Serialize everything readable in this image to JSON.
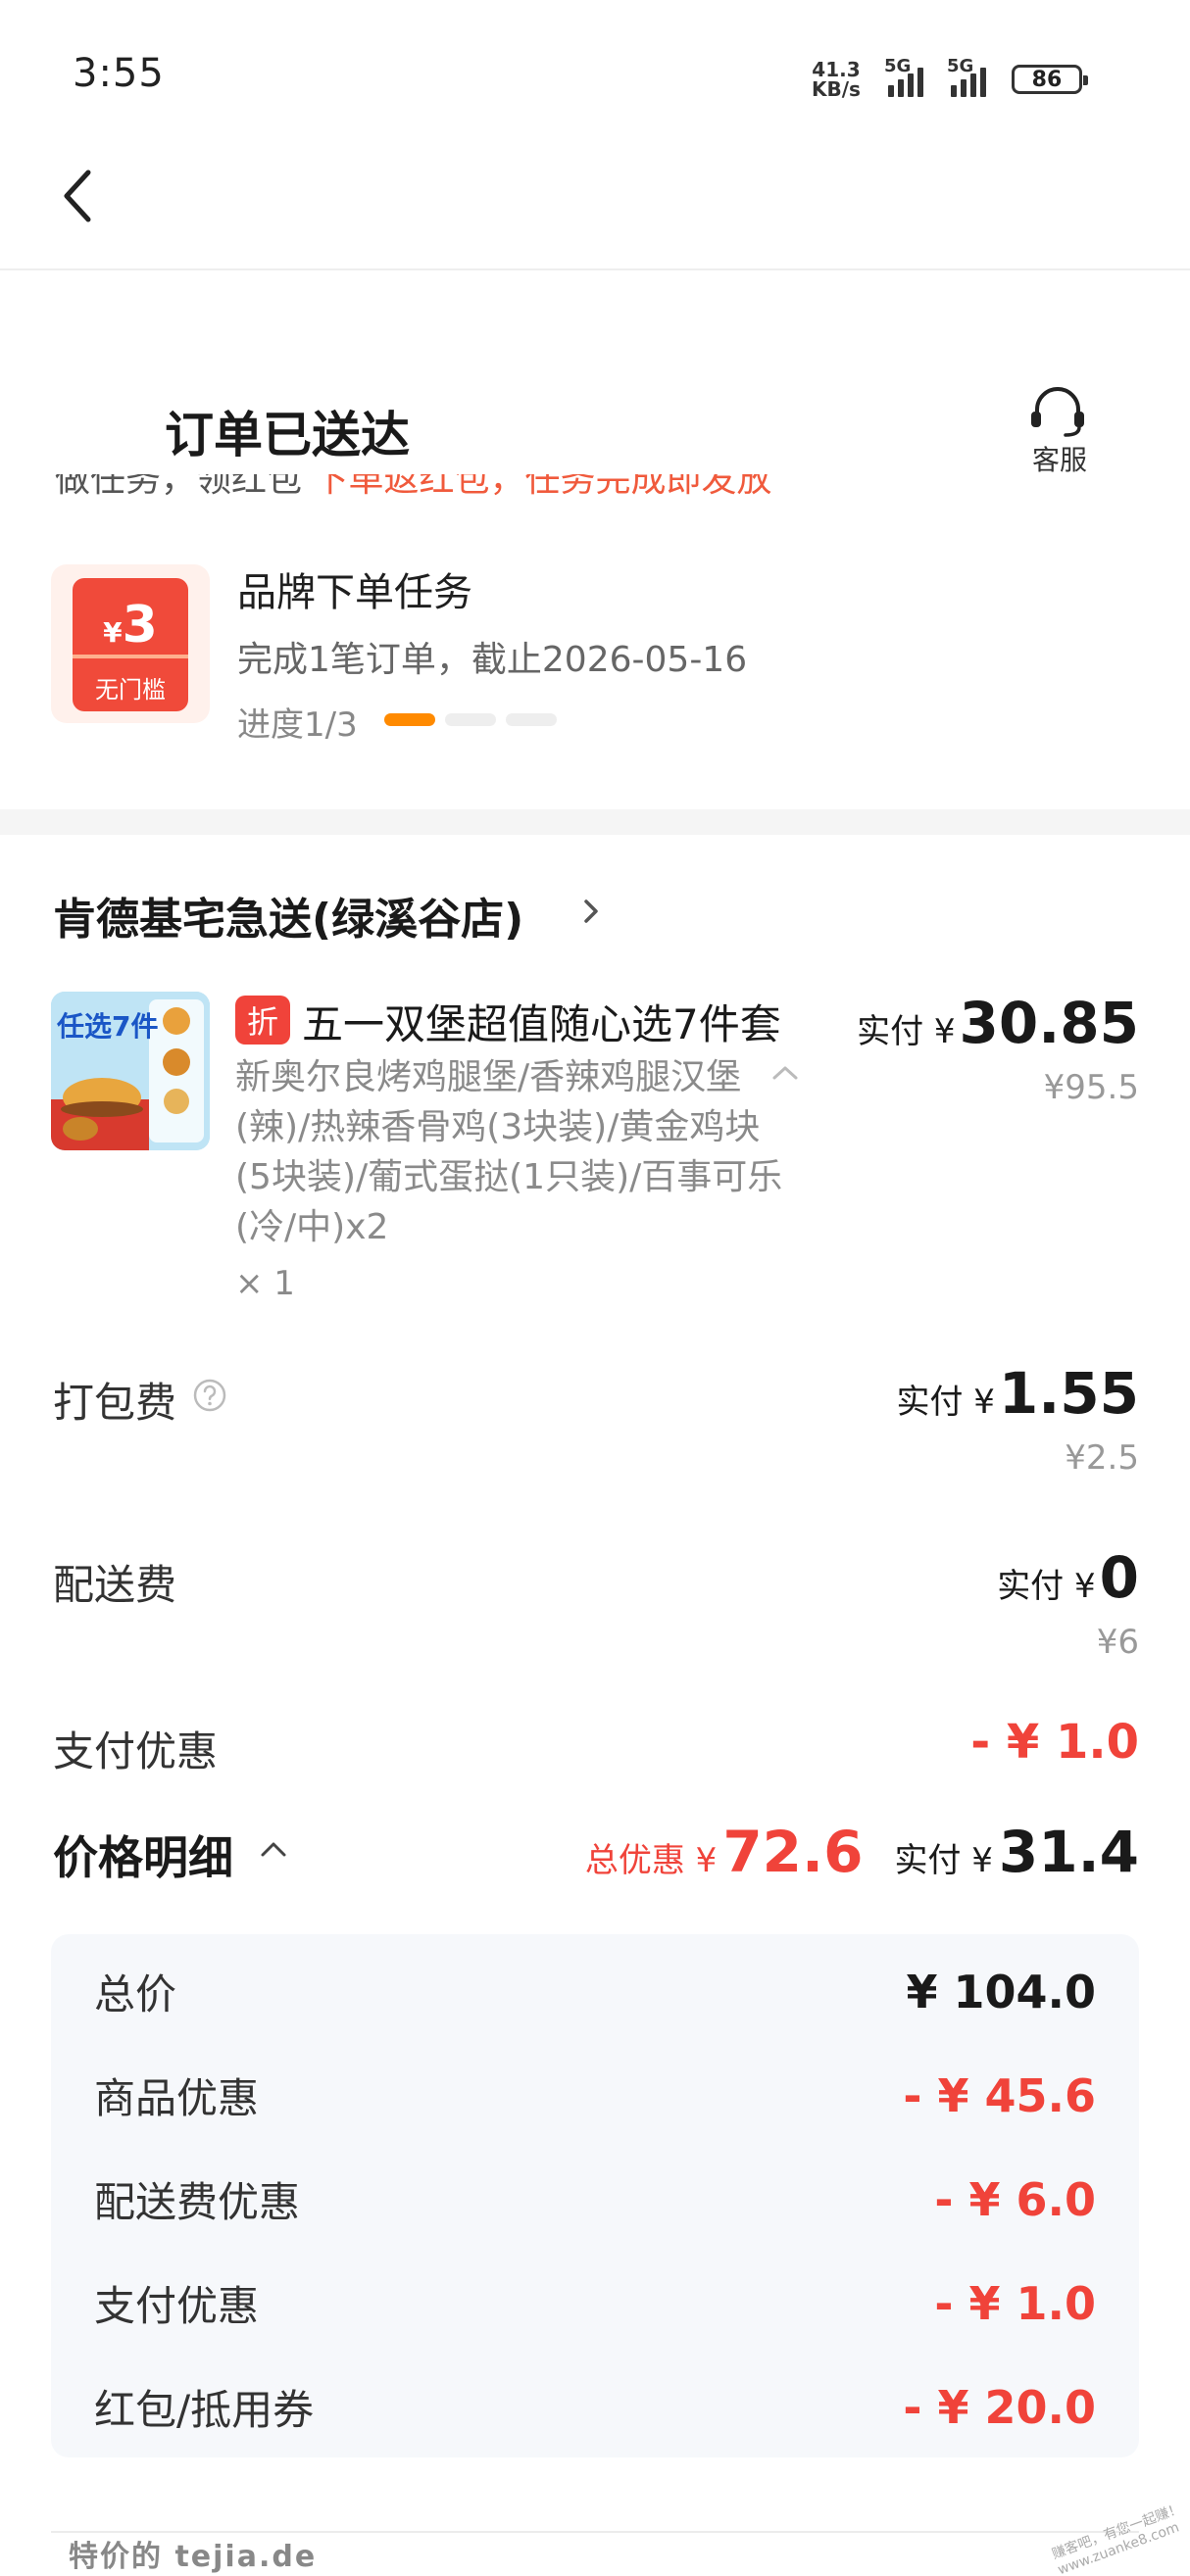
{
  "status_bar": {
    "time": "3:55",
    "net_speed_value": "41.3",
    "net_speed_unit": "KB/s",
    "sim1": "5G",
    "sim2": "5G",
    "battery": "86"
  },
  "header": {
    "title": "订单已送达",
    "service_label": "客服"
  },
  "task": {
    "partial_text_dark": "做任务，领红包",
    "partial_text_red": "下单返红包，任务完成即发放",
    "coupon_symbol": "¥",
    "coupon_amount": "3",
    "coupon_label": "无门槛",
    "name": "品牌下单任务",
    "desc": "完成1笔订单，截止2026-05-16",
    "progress_label": "进度1/3",
    "progress_done": 1,
    "progress_total": 3
  },
  "store": {
    "name": "肯德基宅急送(绿溪谷店)"
  },
  "product": {
    "badge": "折",
    "name": "五一双堡超值随心选7件套",
    "desc": "新奥尔良烤鸡腿堡/香辣鸡腿汉堡(辣)/热辣香骨鸡(3块装)/黄金鸡块(5块装)/葡式蛋挞(1只装)/百事可乐(冷/中)x2",
    "qty": "× 1",
    "pay_label": "实付 ¥",
    "pay_amount": "30.85",
    "original": "¥95.5",
    "image_text": "任选7件"
  },
  "fees": {
    "packing": {
      "label": "打包费",
      "pay_label": "实付 ¥",
      "amount": "1.55",
      "original": "¥2.5"
    },
    "delivery": {
      "label": "配送费",
      "pay_label": "实付 ¥",
      "amount": "0",
      "original": "¥6"
    },
    "pay_discount": {
      "label": "支付优惠",
      "amount": "- ¥ 1.0"
    }
  },
  "price_detail": {
    "title": "价格明细",
    "total_off_label": "总优惠 ¥",
    "total_off_amount": "72.6",
    "pay_label": "实付 ¥",
    "pay_amount": "31.4",
    "rows": [
      {
        "label": "总价",
        "value": "¥ 104.0"
      },
      {
        "label": "商品优惠",
        "value": "- ¥ 45.6"
      },
      {
        "label": "配送费优惠",
        "value": "- ¥ 6.0"
      },
      {
        "label": "支付优惠",
        "value": "- ¥ 1.0"
      },
      {
        "label": "红包/抵用券",
        "value": "- ¥ 20.0"
      }
    ]
  },
  "watermark": {
    "text": "特价的  tejia.de",
    "corner": "赚客吧，有您一起赚！ www.zuanke8.com"
  },
  "colors": {
    "accent_red": "#f0433a",
    "progress_orange": "#ff8a00",
    "muted": "#999999"
  }
}
